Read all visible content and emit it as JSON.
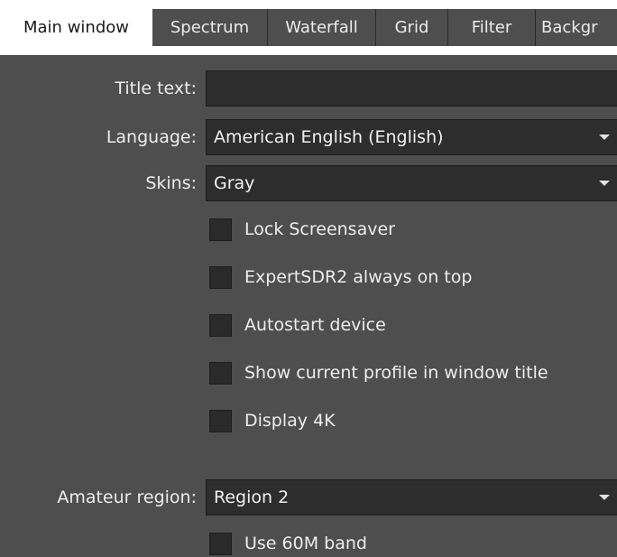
{
  "tabs": [
    {
      "label": "Main window",
      "active": true
    },
    {
      "label": "Spectrum",
      "active": false
    },
    {
      "label": "Waterfall",
      "active": false
    },
    {
      "label": "Grid",
      "active": false
    },
    {
      "label": "Filter",
      "active": false
    },
    {
      "label": "Backgr",
      "active": false
    }
  ],
  "form": {
    "title_label": "Title text:",
    "title_value": "",
    "language_label": "Language:",
    "language_value": "American English (English)",
    "skins_label": "Skins:",
    "skins_value": "Gray",
    "region_label": "Amateur region:",
    "region_value": "Region 2"
  },
  "options": [
    {
      "label": "Lock Screensaver",
      "checked": false
    },
    {
      "label": "ExpertSDR2 always on top",
      "checked": false
    },
    {
      "label": "Autostart device",
      "checked": false
    },
    {
      "label": "Show current profile in window title",
      "checked": false
    },
    {
      "label": "Display 4K",
      "checked": false
    }
  ],
  "region_options": [
    {
      "label": "Use 60M band",
      "checked": false
    }
  ],
  "colors": {
    "background": "#4e4e4e",
    "field": "#2d2d2d",
    "active_tab": "#ffffff"
  }
}
